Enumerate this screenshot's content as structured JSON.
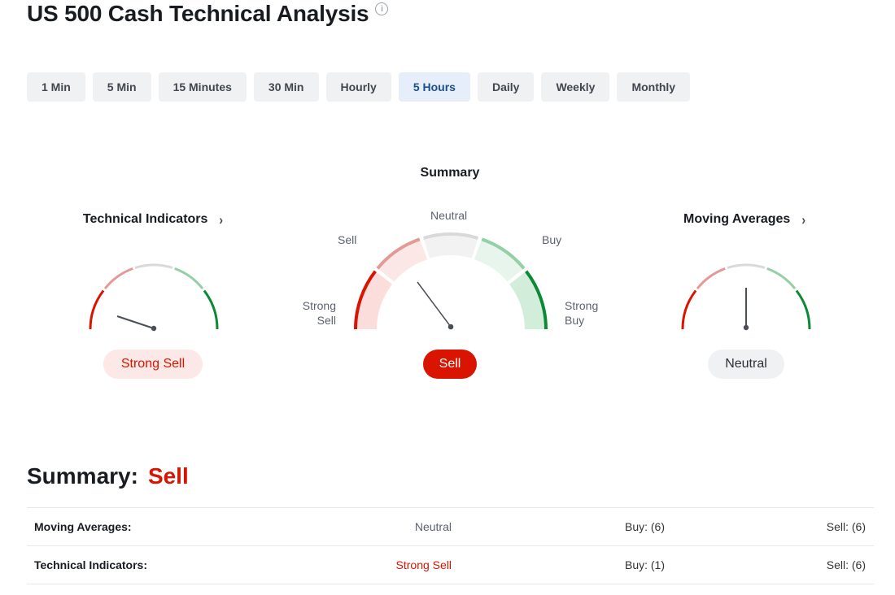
{
  "page": {
    "title": "US 500 Cash Technical Analysis",
    "info_icon": "info-icon"
  },
  "timeframes": [
    {
      "label": "1 Min",
      "active": false
    },
    {
      "label": "5 Min",
      "active": false
    },
    {
      "label": "15 Minutes",
      "active": false
    },
    {
      "label": "30 Min",
      "active": false
    },
    {
      "label": "Hourly",
      "active": false
    },
    {
      "label": "5 Hours",
      "active": true
    },
    {
      "label": "Daily",
      "active": false
    },
    {
      "label": "Weekly",
      "active": false
    },
    {
      "label": "Monthly",
      "active": false
    }
  ],
  "gauges": {
    "technical_indicators": {
      "title": "Technical Indicators",
      "value": "Strong Sell",
      "level": "strong-sell"
    },
    "summary": {
      "title": "Summary",
      "value": "Sell",
      "level": "sell",
      "labels": {
        "strong_sell": "Strong\nSell",
        "sell": "Sell",
        "neutral": "Neutral",
        "buy": "Buy",
        "strong_buy": "Strong\nBuy"
      }
    },
    "moving_averages": {
      "title": "Moving Averages",
      "value": "Neutral",
      "level": "neutral"
    }
  },
  "colors": {
    "strong_sell": "#d91400",
    "sell": "#e39a96",
    "neutral": "#d9d9d9",
    "buy": "#95cfa5",
    "strong_buy": "#0b8a35",
    "accent_blue": "#1a4f8b"
  },
  "summary": {
    "heading": "Summary:",
    "value": "Sell",
    "rows": [
      {
        "label": "Moving Averages:",
        "status": "Neutral",
        "buy": "Buy: (6)",
        "sell": "Sell: (6)"
      },
      {
        "label": "Technical Indicators:",
        "status": "Strong Sell",
        "buy": "Buy: (1)",
        "sell": "Sell: (6)"
      }
    ]
  }
}
